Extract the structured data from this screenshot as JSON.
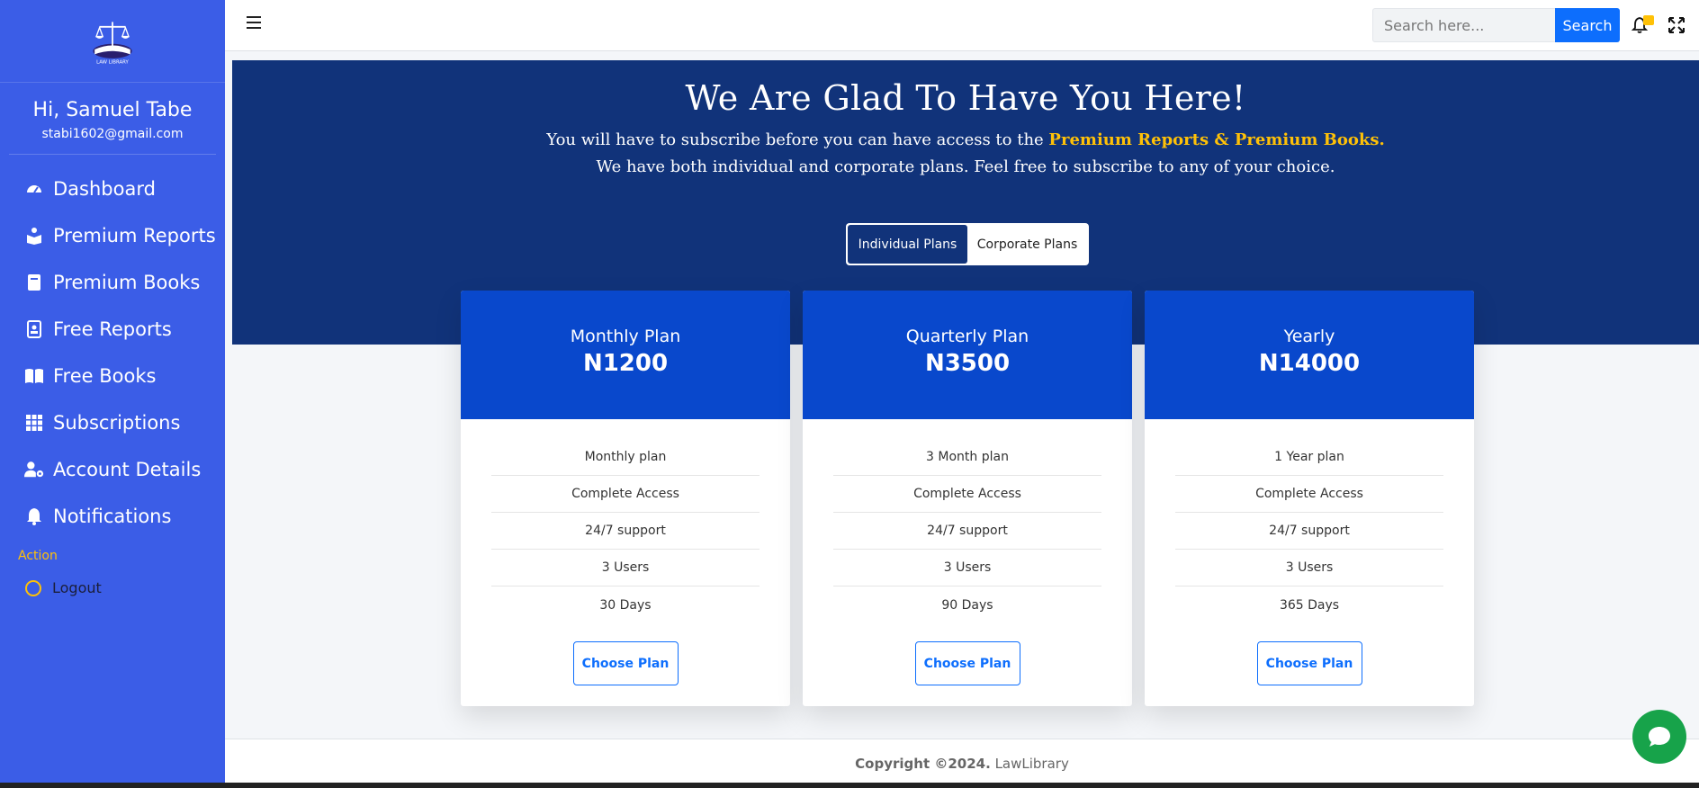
{
  "brand": {
    "logo_text": "LAW LIBRARY"
  },
  "user": {
    "greeting": "Hi, Samuel Tabe",
    "email": "stabi1602@gmail.com"
  },
  "sidebar": {
    "items": [
      {
        "label": "Dashboard",
        "icon": "gauge-icon"
      },
      {
        "label": "Premium Reports",
        "icon": "reader-icon"
      },
      {
        "label": "Premium Books",
        "icon": "book-icon"
      },
      {
        "label": "Free Reports",
        "icon": "report-icon"
      },
      {
        "label": "Free Books",
        "icon": "open-book-icon"
      },
      {
        "label": "Subscriptions",
        "icon": "grid-icon"
      },
      {
        "label": "Account Details",
        "icon": "user-cog-icon"
      },
      {
        "label": "Notifications",
        "icon": "bell-icon"
      }
    ],
    "section_label": "Action",
    "logout_label": "Logout"
  },
  "topbar": {
    "search_placeholder": "Search here...",
    "search_button": "Search"
  },
  "hero": {
    "title": "We Are Glad To Have You Here!",
    "line1_prefix": "You will have to subscribe before you can have access to the ",
    "line1_highlight": "Premium Reports & Premium Books.",
    "line2": "We have both individual and corporate plans. Feel free to subscribe to any of your choice."
  },
  "plan_toggle": {
    "individual": "Individual Plans",
    "corporate": "Corporate Plans",
    "selected": "individual"
  },
  "plans": [
    {
      "title": "Monthly Plan",
      "price": "N1200",
      "features": [
        "Monthly plan",
        "Complete Access",
        "24/7 support",
        "3 Users",
        "30 Days"
      ],
      "button": "Choose Plan"
    },
    {
      "title": "Quarterly Plan",
      "price": "N3500",
      "features": [
        "3 Month plan",
        "Complete Access",
        "24/7 support",
        "3 Users",
        "90 Days"
      ],
      "button": "Choose Plan"
    },
    {
      "title": "Yearly",
      "price": "N14000",
      "features": [
        "1 Year plan",
        "Complete Access",
        "24/7 support",
        "3 Users",
        "365 Days"
      ],
      "button": "Choose Plan"
    }
  ],
  "footer": {
    "copyright": "Copyright ©2024.",
    "brand": "LawLibrary"
  },
  "colors": {
    "sidebar": "#3b5de7",
    "hero": "#11337a",
    "card_head": "#0948cc",
    "accent": "#ffc107",
    "primary": "#0d6efd",
    "chat": "#17a34a"
  }
}
